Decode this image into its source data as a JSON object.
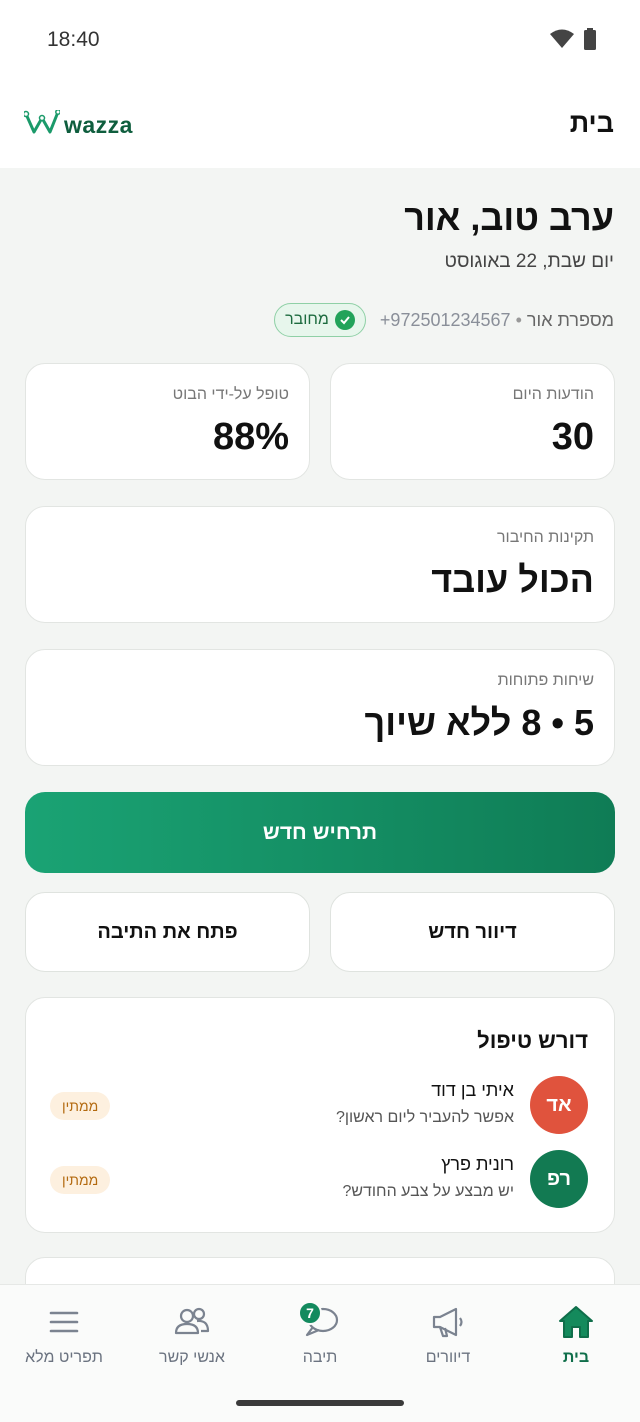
{
  "status_bar": {
    "time": "18:40"
  },
  "header": {
    "logo_text": "wazza",
    "title": "בית"
  },
  "greeting": {
    "title": "ערב טוב, אור",
    "date": "יום שבת, 22 באוגוסט"
  },
  "connection": {
    "status": "מחובר",
    "number_label": "מספרת אור",
    "separator": "•",
    "phone": "+972501234567"
  },
  "stats": {
    "messages_today": {
      "label": "הודעות היום",
      "value": "30"
    },
    "bot_handled": {
      "label": "טופל על-ידי הבוט",
      "value": "88%"
    },
    "connection_health": {
      "label": "תקינות החיבור",
      "value": "הכול עובד"
    },
    "open_chats": {
      "label": "שיחות פתוחות",
      "value": "5 • 8 ללא שיוך"
    }
  },
  "actions": {
    "new_scenario": "תרחיש חדש",
    "new_broadcast": "דיוור חדש",
    "open_inbox": "פתח את התיבה"
  },
  "attention": {
    "title": "דורש טיפול",
    "items": [
      {
        "initials": "אד",
        "name": "איתי בן דוד",
        "message": "אפשר להעביר ליום ראשון?",
        "status": "ממתין",
        "color": "#e0533d"
      },
      {
        "initials": "רפ",
        "name": "רונית פרץ",
        "message": "יש מבצע על צבע החודש?",
        "status": "ממתין",
        "color": "#127a52"
      }
    ]
  },
  "nav": {
    "items": [
      {
        "label": "בית",
        "icon": "home-icon",
        "active": true
      },
      {
        "label": "דיוורים",
        "icon": "megaphone-icon"
      },
      {
        "label": "תיבה",
        "icon": "chat-icon",
        "badge": "7"
      },
      {
        "label": "אנשי קשר",
        "icon": "contacts-icon"
      },
      {
        "label": "תפריט מלא",
        "icon": "menu-icon"
      }
    ]
  },
  "colors": {
    "brand": "#0f6e4a",
    "accent_start": "#1aa374",
    "accent_end": "#0f7c55",
    "background": "#f3f5f3"
  }
}
